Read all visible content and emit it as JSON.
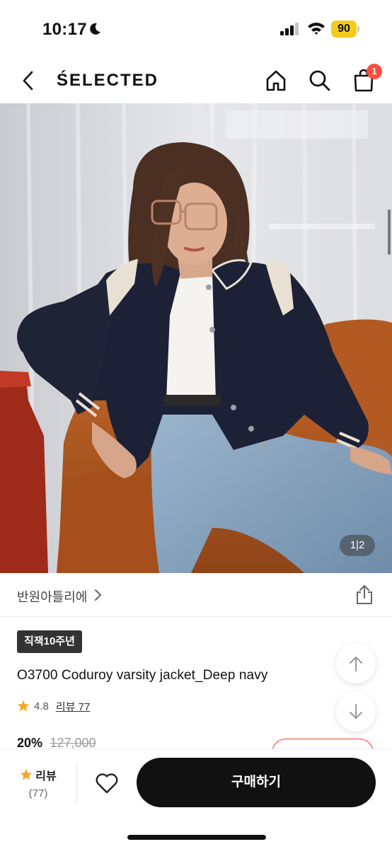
{
  "status_bar": {
    "time": "10:17",
    "battery": "90",
    "icons": [
      "moon-icon",
      "signal-icon",
      "wifi-icon",
      "battery-icon"
    ]
  },
  "header": {
    "brand": "ŚELECTED",
    "cart_badge": "1",
    "icons": [
      "chevron-left-icon",
      "home-icon",
      "search-icon",
      "shopping-bag-icon"
    ]
  },
  "gallery": {
    "indicator": "1|2"
  },
  "seller": {
    "name": "반원아틀리에",
    "icons": [
      "chevron-right-icon",
      "share-icon"
    ]
  },
  "product": {
    "tag": "직잭10주년",
    "title": "O3700 Coduroy varsity jacket_Deep navy",
    "rating": "4.8",
    "review_link": "리뷰 77",
    "discount": "20%",
    "original_price": "127,000"
  },
  "bottom_bar": {
    "review_label": "리뷰",
    "review_count": "(77)",
    "buy_label": "구매하기",
    "icons": [
      "star-icon",
      "heart-icon"
    ]
  },
  "colors": {
    "accent_star": "#f5a623",
    "badge": "#ff4b3e",
    "battery": "#f4cc1e",
    "buy_button": "#111111",
    "jacket_navy": "#1c2135",
    "chair_orange": "#b65a22"
  }
}
